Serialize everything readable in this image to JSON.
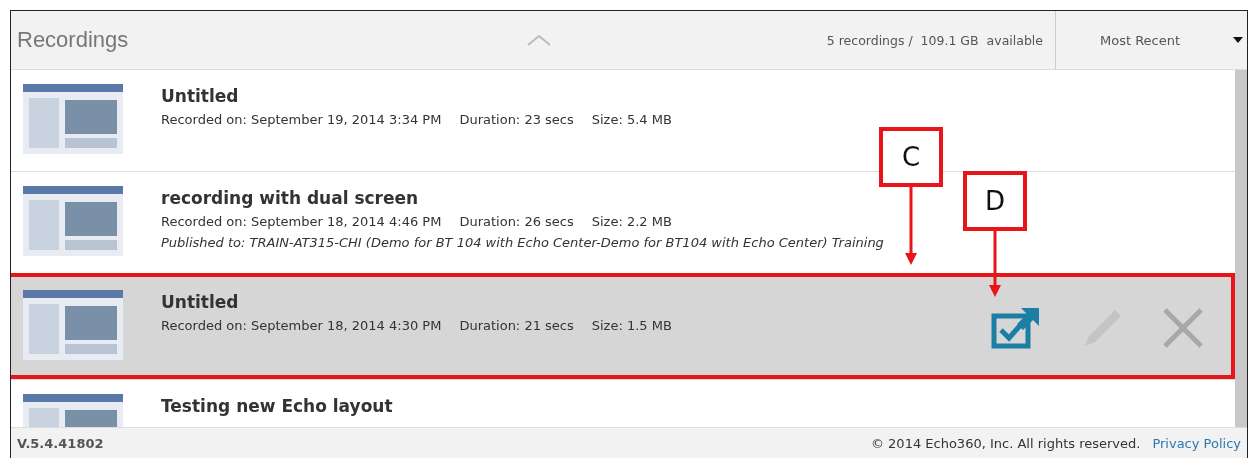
{
  "header": {
    "title": "Recordings",
    "summary": "5 recordings /  109.1 GB  available",
    "sort": "Most Recent"
  },
  "recordings": [
    {
      "title": "Untitled",
      "recorded": "Recorded on: September 19, 2014 3:34 PM",
      "duration": "Duration: 23 secs",
      "size": "Size: 5.4 MB",
      "selected": false
    },
    {
      "title": "recording with dual screen",
      "recorded": "Recorded on: September 18, 2014 4:46 PM",
      "duration": "Duration: 26 secs",
      "size": "Size: 2.2 MB",
      "published": "Published to: TRAIN-AT315-CHI (Demo for BT 104 with Echo Center-Demo for BT104 with Echo Center) Training",
      "selected": false
    },
    {
      "title": "Untitled",
      "recorded": "Recorded on: September 18, 2014 4:30 PM",
      "duration": "Duration: 21 secs",
      "size": "Size: 1.5 MB",
      "selected": true
    },
    {
      "title": "Testing new Echo layout",
      "selected": false
    }
  ],
  "callouts": [
    {
      "label": "C"
    },
    {
      "label": "D"
    }
  ],
  "footer": {
    "version": "V.5.4.41802",
    "copyright": "© 2014 Echo360, Inc. All rights reserved.",
    "link": "Privacy Policy"
  }
}
